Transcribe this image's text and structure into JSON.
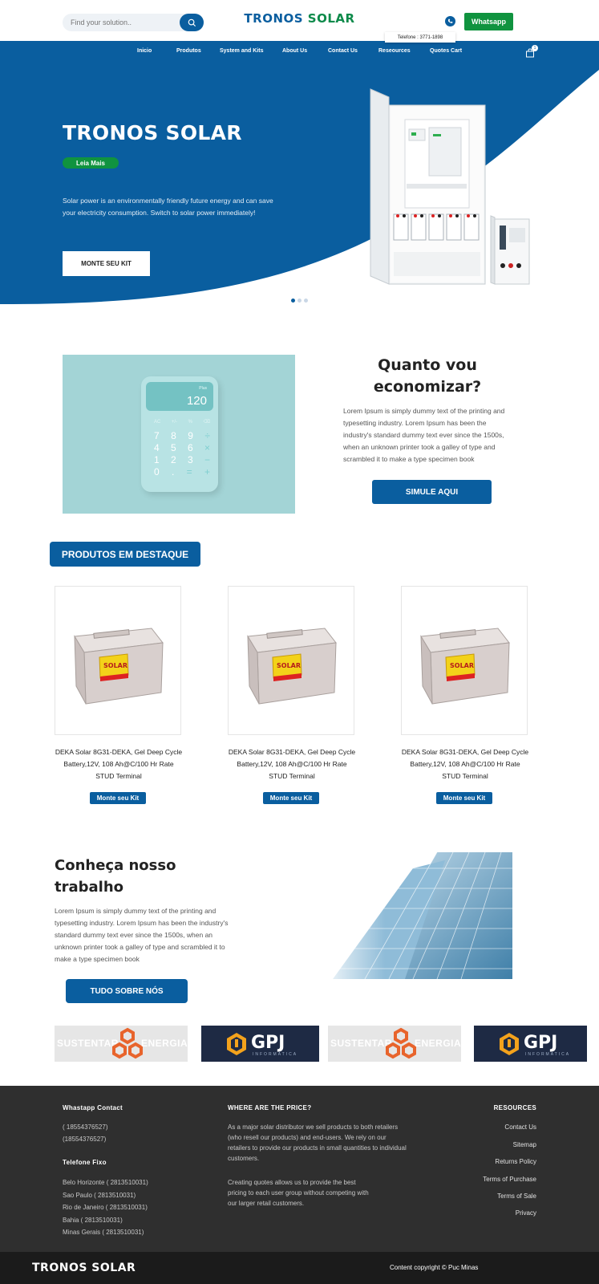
{
  "header": {
    "search_placeholder": "Find your solution..",
    "brand_part1": "TRONOS",
    "brand_part2": "SOLAR",
    "whatsapp_label": "Whatsapp",
    "phone_tooltip": "Telefone : 3771-1898"
  },
  "nav": {
    "items": [
      {
        "label": "Inicio"
      },
      {
        "label": "Produtos"
      },
      {
        "label": "System and Kits"
      },
      {
        "label": "About Us"
      },
      {
        "label": "Contact Us"
      },
      {
        "label": "Reseources"
      },
      {
        "label": "Quotes Cart"
      }
    ],
    "cart_count": "1"
  },
  "hero": {
    "title": "TRONOS SOLAR",
    "badge": "Leia Mais",
    "text": "Solar power is an environmentally friendly future energy and can save your electricity consumption. Switch to solar power immediately!",
    "cta": "MONTE SEU KIT",
    "slide_count": 3,
    "active_slide": 1
  },
  "calculator": {
    "screen_small": "Plus",
    "screen_value": "120",
    "fn_row": [
      "AC",
      "+/-",
      "%",
      "⌫"
    ],
    "rows": [
      [
        "7",
        "8",
        "9",
        "÷"
      ],
      [
        "4",
        "5",
        "6",
        "×"
      ],
      [
        "1",
        "2",
        "3",
        "−"
      ],
      [
        "0",
        ".",
        "=",
        "+"
      ]
    ]
  },
  "savings": {
    "title": "Quanto vou economizar?",
    "text": "Lorem Ipsum is simply dummy text of the printing and typesetting industry. Lorem Ipsum has been the industry's standard dummy text ever since the 1500s, when an unknown printer took a galley of type and scrambled it to make a type specimen book",
    "cta": "SIMULE AQUI"
  },
  "featured": {
    "title": "PRODUTOS EM DESTAQUE",
    "products": [
      {
        "name": "DEKA Solar 8G31-DEKA, Gel Deep Cycle Battery,12V, 108 Ah@C/100 Hr Rate STUD Terminal",
        "button": "Monte seu Kit",
        "label_brand": "SOLAR"
      },
      {
        "name": "DEKA Solar 8G31-DEKA, Gel Deep Cycle Battery,12V, 108 Ah@C/100 Hr Rate STUD Terminal",
        "button": "Monte seu Kit",
        "label_brand": "SOLAR"
      },
      {
        "name": "DEKA Solar 8G31-DEKA, Gel Deep Cycle Battery,12V, 108 Ah@C/100 Hr Rate STUD Terminal",
        "button": "Monte seu Kit",
        "label_brand": "SOLAR"
      }
    ]
  },
  "about": {
    "title": "Conheça nosso trabalho",
    "text": "Lorem Ipsum is simply dummy text of the printing and typesetting industry. Lorem Ipsum has been the industry's standard dummy text ever since the 1500s, when an unknown printer took a galley of type and scrambled it to make a type specimen book",
    "cta": "TUDO SOBRE NÓS"
  },
  "partners": [
    {
      "type": "sustentar",
      "left_text": "SUSTENTAR",
      "right_text": "ENERGIA"
    },
    {
      "type": "gpj",
      "logo": "GPJ",
      "sub": "INFORMATICA"
    },
    {
      "type": "sustentar",
      "left_text": "SUSTENTAR",
      "right_text": "ENERGIA"
    },
    {
      "type": "gpj",
      "logo": "GPJ",
      "sub": "INFORMATICA"
    }
  ],
  "footer": {
    "whatsapp_heading": "Whastapp Contact",
    "whatsapp_numbers": [
      "( 18554376527)",
      "(18554376527)"
    ],
    "fixo_heading": "Telefone Fixo",
    "fixo_numbers": [
      "Belo Horizonte ( 2813510031)",
      "Sao Paulo ( 2813510031)",
      "Rio de Janeiro ( 2813510031)",
      "Bahia ( 2813510031)",
      "Minas Gerais ( 2813510031)"
    ],
    "price_heading": "WHERE ARE THE PRICE?",
    "price_para1": "As a major solar distributor we sell products to both retailers (who resell our products) and end-users. We rely on our retailers to provide our products in small quantities to individual customers.",
    "price_para2": "Creating quotes allows us to provide the best pricing to each user group without competing with our larger retail customers.",
    "resources_heading": "RESOURCES",
    "resources_links": [
      "Contact Us",
      "Sitemap",
      "Returns Policy",
      "Terms of Purchase",
      "Terms of Sale",
      "Privacy"
    ]
  },
  "bottom": {
    "brand": "TRONOS SOLAR",
    "copyright": "Content copyright © Puc Minas"
  },
  "colors": {
    "primary": "#0a5e9f",
    "accent_green": "#10933f",
    "footer_bg": "#2f2f2f"
  }
}
